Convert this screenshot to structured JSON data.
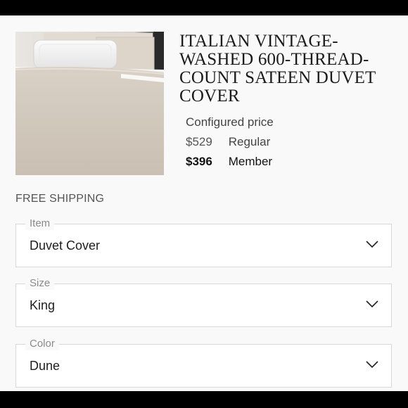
{
  "product": {
    "title": "ITALIAN VINTAGE-WASHED 600-THREAD-COUNT SATEEN DUVET COVER",
    "image_icon": "bedding-photo"
  },
  "pricing": {
    "configured_label": "Configured price",
    "regular_price": "$529",
    "regular_label": "Regular",
    "member_price": "$396",
    "member_label": "Member"
  },
  "shipping": {
    "label": "FREE SHIPPING"
  },
  "options": {
    "item": {
      "label": "Item",
      "value": "Duvet Cover"
    },
    "size": {
      "label": "Size",
      "value": "King"
    },
    "color": {
      "label": "Color",
      "value": "Dune"
    }
  },
  "icons": {
    "dropdown": "chevron-down-icon"
  },
  "colors": {
    "background": "#f9f9f9",
    "border": "#d8d8d8",
    "text": "#222222"
  }
}
